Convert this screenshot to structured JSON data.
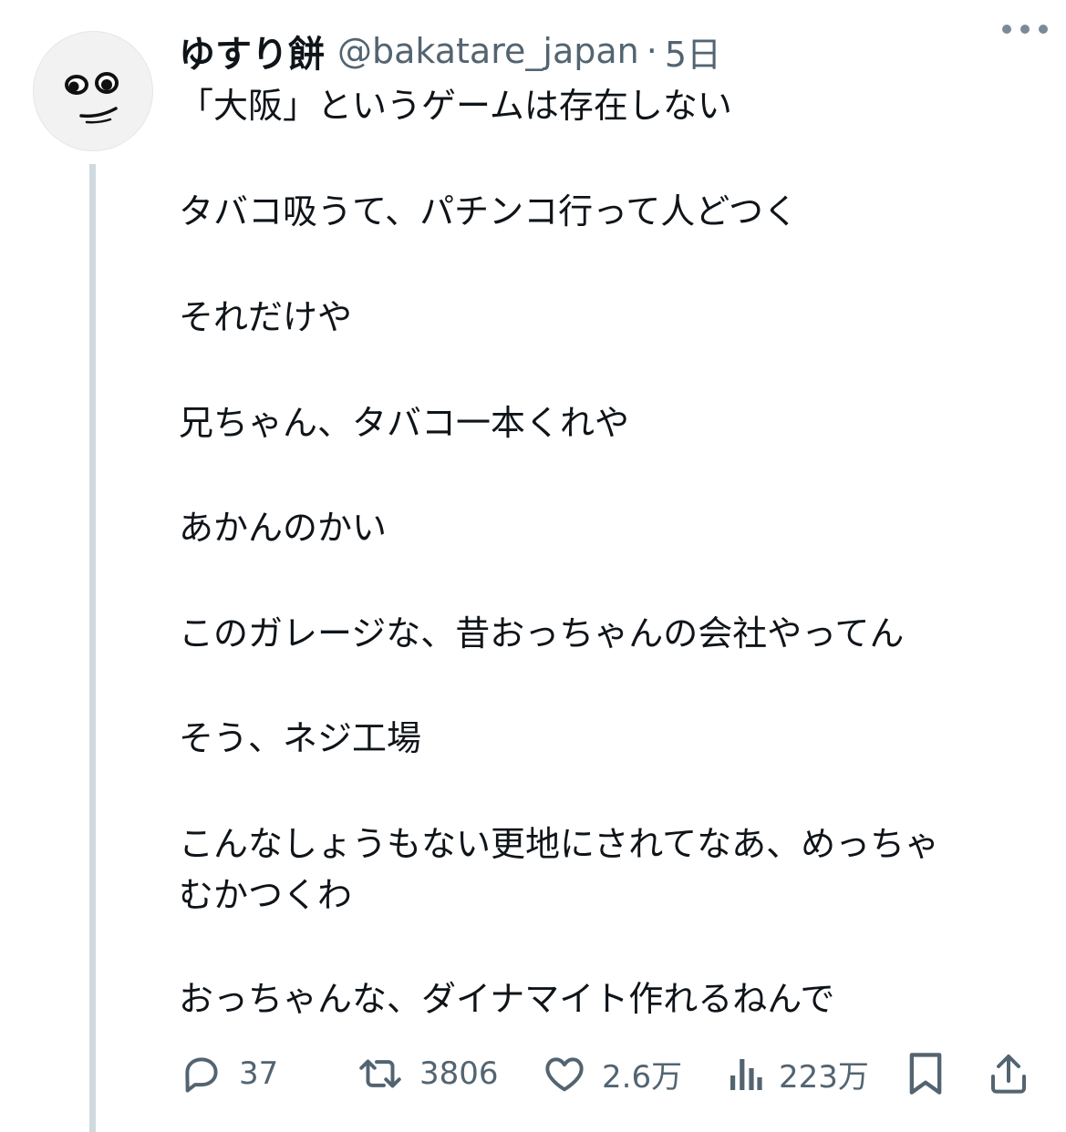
{
  "tweet": {
    "display_name": "ゆすり餅",
    "handle": "@bakatare_japan",
    "separator": "·",
    "time": "5日",
    "lines": [
      "「大阪」というゲームは存在しない",
      "タバコ吸うて、パチンコ行って人どつく",
      "それだけや",
      "兄ちゃん、タバコ一本くれや",
      "あかんのかい",
      "このガレージな、昔おっちゃんの会社やってん",
      "そう、ネジ工場",
      "こんなしょうもない更地にされてなあ、めっちゃ",
      "むかつくわ",
      "おっちゃんな、ダイナマイト作れるねんで"
    ]
  },
  "actions": {
    "replies": "37",
    "retweets": "3806",
    "likes": "2.6万",
    "views": "223万"
  },
  "icons": {
    "more": "more-horizontal-icon",
    "reply": "reply-icon",
    "retweet": "retweet-icon",
    "like": "heart-icon",
    "views": "views-icon",
    "bookmark": "bookmark-icon",
    "share": "share-icon"
  },
  "colors": {
    "text": "#0f1419",
    "secondary": "#536471",
    "thread_line": "#cfd9de"
  }
}
